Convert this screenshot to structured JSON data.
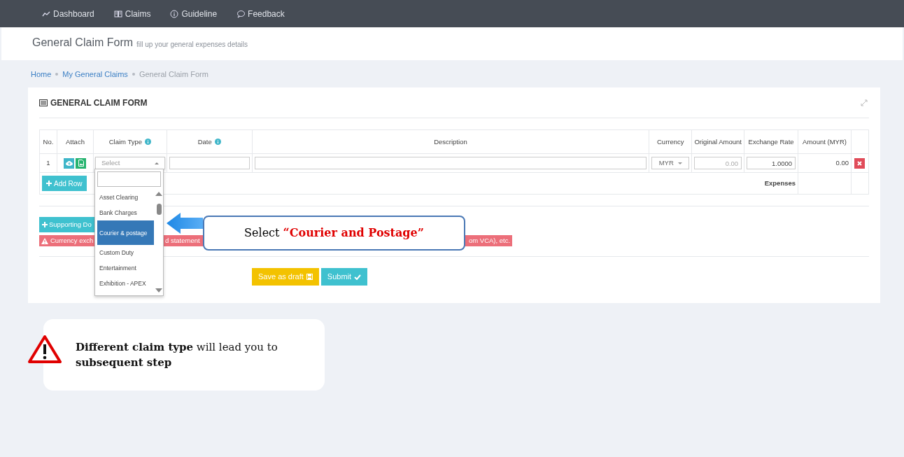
{
  "nav": [
    {
      "label": "Dashboard"
    },
    {
      "label": "Claims"
    },
    {
      "label": "Guideline"
    },
    {
      "label": "Feedback"
    }
  ],
  "header": {
    "title": "General Claim Form",
    "subtitle": "fill up your general expenses details"
  },
  "breadcrumb": [
    {
      "label": "Home",
      "current": false
    },
    {
      "label": "My General Claims",
      "current": false
    },
    {
      "label": "General Claim Form",
      "current": true
    }
  ],
  "card": {
    "title": "GENERAL CLAIM FORM"
  },
  "table": {
    "columns": [
      {
        "label": "No.",
        "info": false
      },
      {
        "label": "Attach",
        "info": false
      },
      {
        "label": "Claim Type",
        "info": true
      },
      {
        "label": "Date",
        "info": true
      },
      {
        "label": "Description",
        "info": false
      },
      {
        "label": "Currency",
        "info": false
      },
      {
        "label": "Original Amount",
        "info": false
      },
      {
        "label": "Exchange Rate",
        "info": false
      },
      {
        "label": "Amount (MYR)",
        "info": false
      }
    ],
    "rows": [
      {
        "no": "1",
        "claim_type": {
          "placeholder": "Select",
          "open": true
        },
        "currency": "MYR",
        "original_amount": {
          "placeholder": "0.00"
        },
        "exchange_rate": "1.0000",
        "amount": "0.00"
      }
    ],
    "add_row": "Add Row",
    "footer_label": "Expenses"
  },
  "dropdown": {
    "options": [
      {
        "label": "Asset Clearing",
        "selected": false
      },
      {
        "label": "Bank Charges",
        "selected": false
      },
      {
        "label": "Courier & postage",
        "selected": true
      },
      {
        "label": "Custom Duty",
        "selected": false
      },
      {
        "label": "Entertainment",
        "selected": false
      },
      {
        "label": "Exhibition - APEX",
        "selected": false
      }
    ]
  },
  "supporting_button": "Supporting Do",
  "warning": [
    "Currency exch",
    "d statement",
    "om VCA), etc."
  ],
  "actions": [
    {
      "label": "Save as draft",
      "kind": "draft"
    },
    {
      "label": "Submit",
      "kind": "submit"
    }
  ],
  "callout": "Select **“Courier and Postage”**",
  "tip": "**Different claim type** will lead you to **subsequent step**"
}
